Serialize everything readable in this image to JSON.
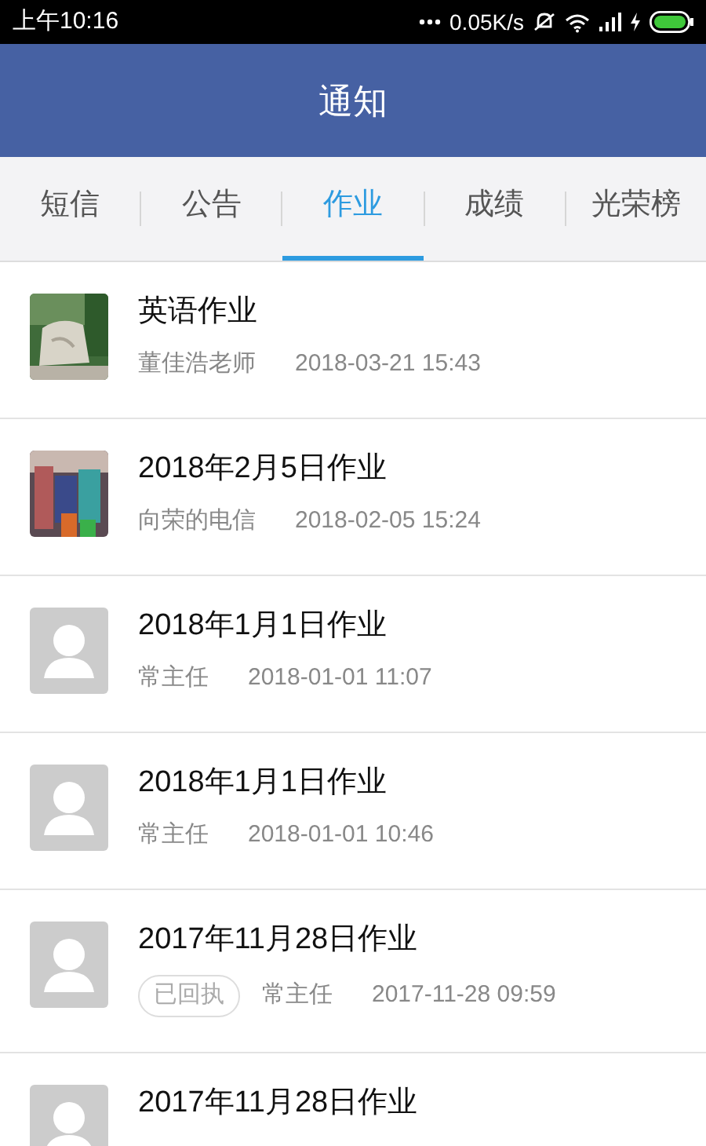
{
  "status_bar": {
    "time": "上午10:16",
    "speed": "0.05K/s"
  },
  "header": {
    "title": "通知"
  },
  "tabs": [
    {
      "label": "短信",
      "selected": false
    },
    {
      "label": "公告",
      "selected": false
    },
    {
      "label": "作业",
      "selected": true
    },
    {
      "label": "成绩",
      "selected": false
    },
    {
      "label": "光荣榜",
      "selected": false
    }
  ],
  "notices": [
    {
      "title": "英语作业",
      "sender": "董佳浩老师",
      "time": "2018-03-21 15:43"
    },
    {
      "title": "2018年2月5日作业",
      "sender": "向荣的电信",
      "time": "2018-02-05 15:24"
    },
    {
      "kind": "placeholder",
      "title": "2018年1月1日作业",
      "sender": "常主任",
      "time": "2018-01-01 11:07"
    },
    {
      "kind": "placeholder",
      "title": "2018年1月1日作业",
      "sender": "常主任",
      "time": "2018-01-01 10:46"
    },
    {
      "kind": "placeholder",
      "title": "2017年11月28日作业",
      "receipt": "已回执",
      "sender": "常主任",
      "time": "2017-11-28 09:59"
    },
    {
      "kind": "placeholder",
      "title": "2017年11月28日作业"
    }
  ]
}
